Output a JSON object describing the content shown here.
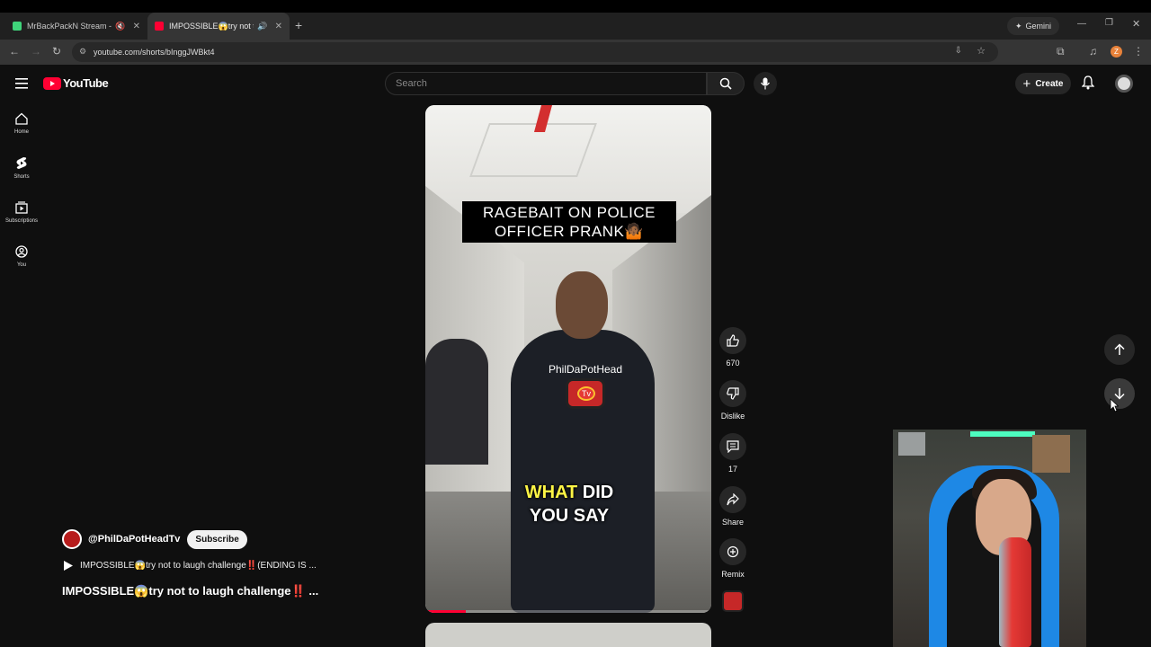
{
  "browser": {
    "tabs": [
      {
        "title": "MrBackPackN Stream - Wa",
        "fav": "#3fd47a"
      },
      {
        "title": "IMPOSSIBLE😱try not to la",
        "fav": "#ff0033"
      }
    ],
    "new_tab": "+",
    "gemini": "Gemini",
    "url": "youtube.com/shorts/bInggJWBkt4",
    "profile_letter": "Z"
  },
  "header": {
    "logo_text": "YouTube",
    "search_placeholder": "Search",
    "create_label": "Create"
  },
  "sidebar": {
    "items": [
      {
        "label": "Home"
      },
      {
        "label": "Shorts"
      },
      {
        "label": "Subscriptions"
      },
      {
        "label": "You"
      }
    ]
  },
  "video": {
    "overlay_title": "RAGEBAIT ON POLICE OFFICER PRANK🤷🏾",
    "watermark": "PhilDaPotHead",
    "watermark_tv": "Tv",
    "caption_hl": "WHAT",
    "caption_rest": " DID",
    "caption_line2": "YOU SAY",
    "progress_fraction": 0.14
  },
  "actions": {
    "likes": "670",
    "dislike": "Dislike",
    "comments": "17",
    "share": "Share",
    "remix": "Remix"
  },
  "channel": {
    "handle": "@PhilDaPotHeadTv",
    "subscribe": "Subscribe",
    "description": "IMPOSSIBLE😱try not to laugh challenge‼️(ENDING IS ...",
    "title": "IMPOSSIBLE😱try not to laugh challenge‼️ ..."
  }
}
